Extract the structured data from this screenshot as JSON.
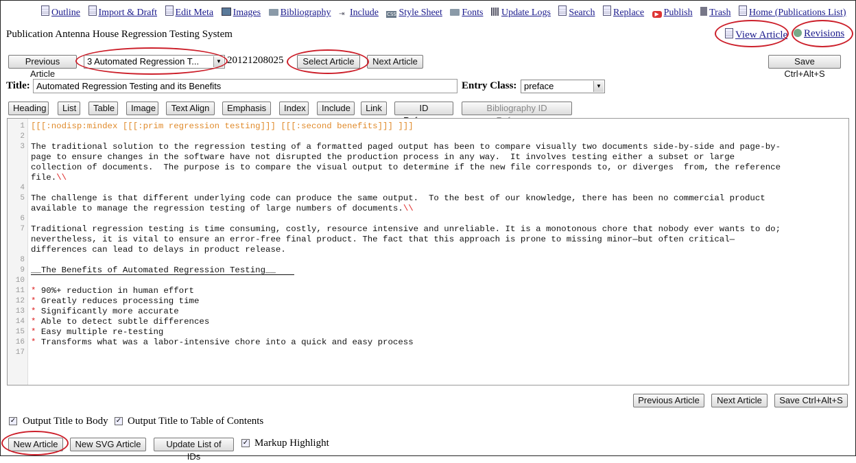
{
  "nav": [
    {
      "label": "Outline",
      "icon": "doc-icon"
    },
    {
      "label": "Import & Draft",
      "icon": "doc-icon"
    },
    {
      "label": "Edit Meta",
      "icon": "doc-icon"
    },
    {
      "label": "Images",
      "icon": "image-icon"
    },
    {
      "label": "Bibliography",
      "icon": "folder-icon"
    },
    {
      "label": "Include",
      "icon": "include-icon"
    },
    {
      "label": "Style Sheet",
      "icon": "css-icon"
    },
    {
      "label": "Fonts",
      "icon": "folder-icon"
    },
    {
      "label": "Update Logs",
      "icon": "grid-icon"
    },
    {
      "label": "Search",
      "icon": "doc-icon"
    },
    {
      "label": "Replace",
      "icon": "doc-icon"
    },
    {
      "label": "Publish",
      "icon": "publish-icon"
    },
    {
      "label": "Trash",
      "icon": "trash-icon"
    },
    {
      "label": "Home (Publications List)",
      "icon": "doc-icon"
    }
  ],
  "publication_title": "Publication Antenna House Regression Testing System",
  "view_article": "View Article",
  "revisions": "Revisions",
  "toolbar": {
    "previous": "Previous Article",
    "article_select": "3 Automated Regression T...",
    "article_id": "20121208025",
    "select_article": "Select Article",
    "next": "Next Article",
    "save": "Save Ctrl+Alt+S"
  },
  "title_label": "Title:",
  "title_value": "Automated Regression Testing and its Benefits",
  "entry_class_label": "Entry Class:",
  "entry_class_value": "preface",
  "markup_buttons": [
    "Heading",
    "List",
    "Table",
    "Image",
    "Text Align",
    "Emphasis",
    "Index",
    "Include",
    "Link",
    "ID Reference",
    "Bibliography ID Reference"
  ],
  "line_numbers": [
    "1",
    "2",
    "3",
    "4",
    "5",
    "6",
    "7",
    "8",
    "9",
    "10",
    "11",
    "12",
    "13",
    "14",
    "15",
    "16",
    "17"
  ],
  "code": {
    "line1": "[[[:nodisp:mindex [[[:prim regression testing]]] [[[:second benefits]]] ]]]",
    "p1a": "The traditional solution to the regression testing of a formatted paged output has been to compare visually two documents side-by-side and page-by-",
    "p1b": "page to ensure changes in the software have not disrupted the production process in any way.  It involves testing either a subset or large",
    "p1c": "collection of documents.  The purpose is to compare the visual output to determine if the new file corresponds to, or diverges  from, the reference",
    "p1d": "file.",
    "p2a": "The challenge is that different underlying code can produce the same output.  To the best of our knowledge, there has been no commercial product",
    "p2b": "available to manage the regression testing of large numbers of documents.",
    "p3a": "Traditional regression testing is time consuming, costly, resource intensive and unreliable. It is a monotonous chore that nobody ever wants to do;",
    "p3b": "nevertheless, it is vital to ensure an error-free final product. The fact that this approach is prone to missing minor—but often critical—",
    "p3c": "differences can lead to delays in product release.",
    "heading": "__The Benefits of Automated Regression Testing__",
    "break": "\\\\",
    "bullet": "*",
    "list": [
      "90%+ reduction in human effort",
      "Greatly reduces processing time",
      "Significantly more accurate",
      "Able to detect subtle differences",
      "Easy multiple re-testing",
      "Transforms what was a labor-intensive chore into a quick and easy process"
    ]
  },
  "bottom": {
    "previous": "Previous Article",
    "next": "Next Article",
    "save": "Save Ctrl+Alt+S",
    "output_title_body": "Output Title to Body",
    "output_title_toc": "Output Title to Table of Contents",
    "new_article": "New Article",
    "new_svg_article": "New SVG Article",
    "update_ids": "Update List of IDs",
    "markup_highlight": "Markup Highlight"
  },
  "colors": {
    "annotation_circle": "#cc1f2a",
    "link": "#1a1a8c",
    "markup_orange": "#e08a2a",
    "markup_red": "#dd2222"
  }
}
